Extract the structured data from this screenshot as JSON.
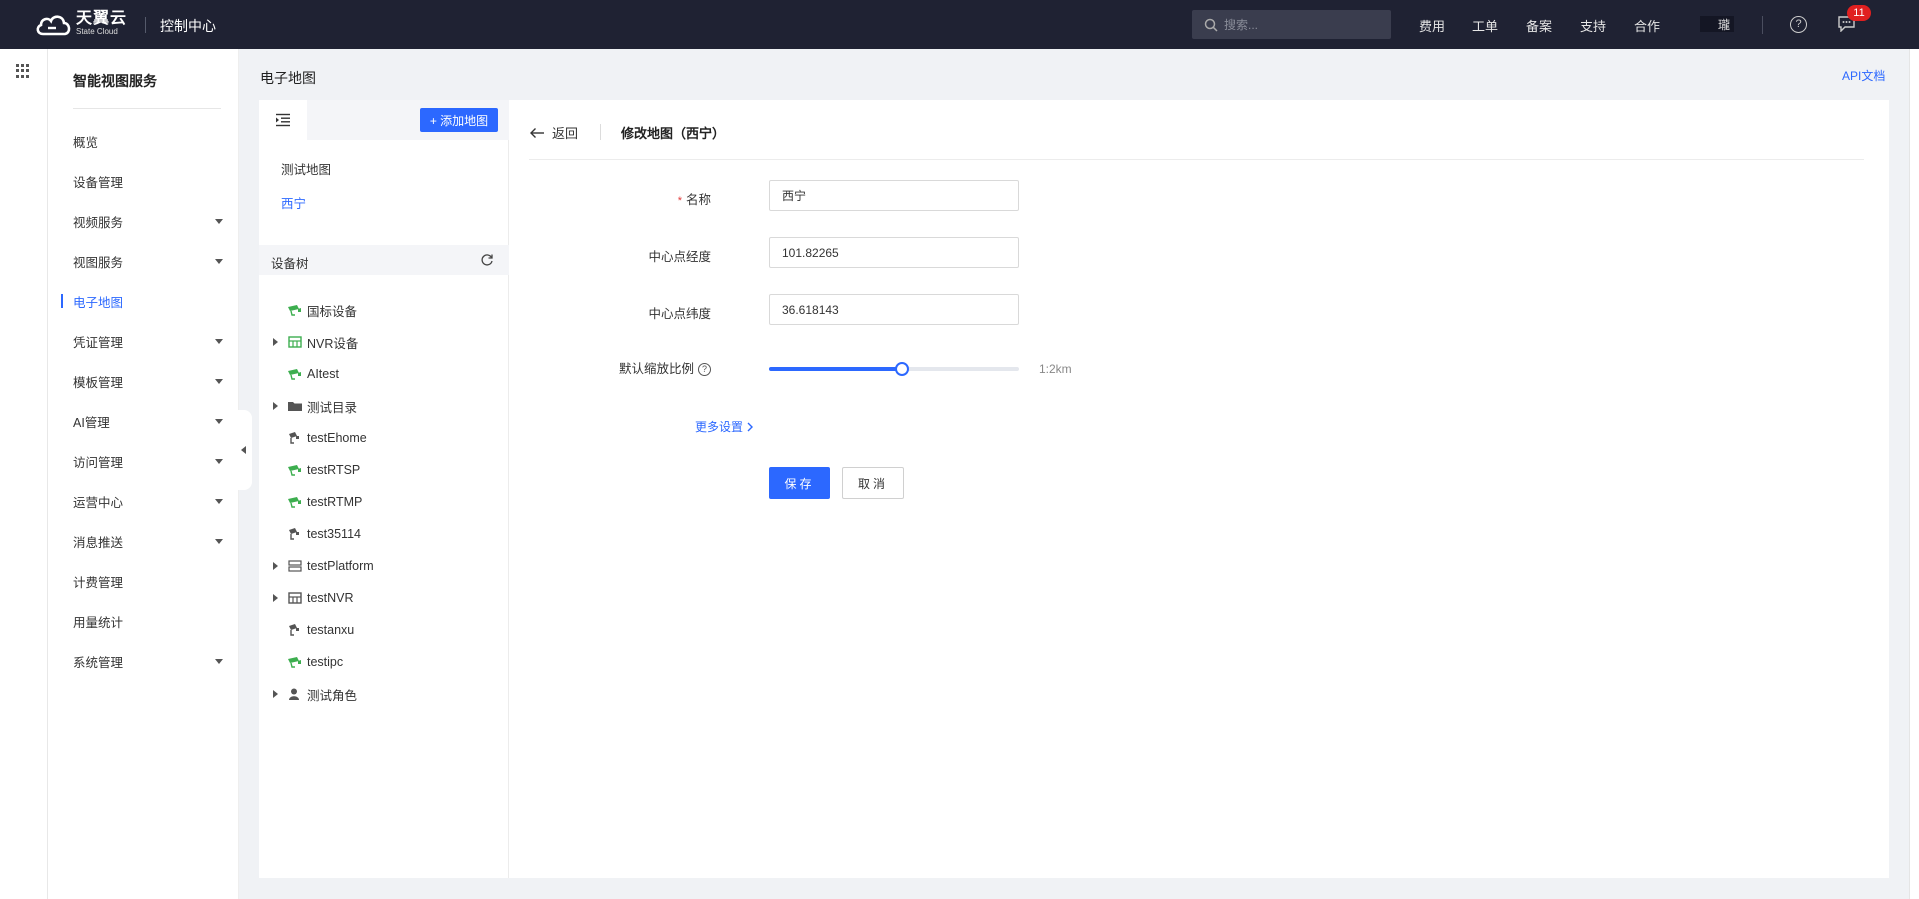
{
  "header": {
    "brand_cn": "天翼云",
    "brand_en": "State Cloud",
    "console_title": "控制中心",
    "search_placeholder": "搜索...",
    "nav": [
      "费用",
      "工单",
      "备案",
      "支持",
      "合作"
    ],
    "user_tag": "瓏",
    "message_badge": "11"
  },
  "sidebar": {
    "title": "智能视图服务",
    "items": [
      {
        "label": "概览",
        "has_caret": false
      },
      {
        "label": "设备管理",
        "has_caret": false
      },
      {
        "label": "视频服务",
        "has_caret": true
      },
      {
        "label": "视图服务",
        "has_caret": true
      },
      {
        "label": "电子地图",
        "has_caret": false,
        "active": true
      },
      {
        "label": "凭证管理",
        "has_caret": true
      },
      {
        "label": "模板管理",
        "has_caret": true
      },
      {
        "label": "AI管理",
        "has_caret": true
      },
      {
        "label": "访问管理",
        "has_caret": true
      },
      {
        "label": "运营中心",
        "has_caret": true
      },
      {
        "label": "消息推送",
        "has_caret": true
      },
      {
        "label": "计费管理",
        "has_caret": false
      },
      {
        "label": "用量统计",
        "has_caret": false
      },
      {
        "label": "系统管理",
        "has_caret": true
      }
    ]
  },
  "page": {
    "title": "电子地图",
    "api_doc": "API文档"
  },
  "map_panel": {
    "add_button": "+ 添加地图",
    "maps": [
      {
        "label": "测试地图",
        "selected": false
      },
      {
        "label": "西宁",
        "selected": true
      }
    ],
    "tree_title": "设备树",
    "tree": [
      {
        "label": "国标设备",
        "expandable": false,
        "icon": "camera-green-icon"
      },
      {
        "label": "NVR设备",
        "expandable": true,
        "icon": "nvr-green-icon"
      },
      {
        "label": "AItest",
        "expandable": false,
        "icon": "camera-green-icon"
      },
      {
        "label": "测试目录",
        "expandable": true,
        "icon": "folder-icon"
      },
      {
        "label": "testEhome",
        "expandable": false,
        "icon": "camera-gray-icon"
      },
      {
        "label": "testRTSP",
        "expandable": false,
        "icon": "camera-green-icon"
      },
      {
        "label": "testRTMP",
        "expandable": false,
        "icon": "camera-green-icon"
      },
      {
        "label": "test35114",
        "expandable": false,
        "icon": "camera-gray-icon"
      },
      {
        "label": "testPlatform",
        "expandable": true,
        "icon": "platform-icon"
      },
      {
        "label": "testNVR",
        "expandable": true,
        "icon": "nvr-gray-icon"
      },
      {
        "label": "testanxu",
        "expandable": false,
        "icon": "camera-gray-icon"
      },
      {
        "label": "testipc",
        "expandable": false,
        "icon": "camera-green-icon"
      },
      {
        "label": "测试角色",
        "expandable": true,
        "icon": "role-icon"
      }
    ]
  },
  "form": {
    "back_label": "返回",
    "title": "修改地图（西宁）",
    "name_label": "名称",
    "name_value": "西宁",
    "lng_label": "中心点经度",
    "lng_value": "101.82265",
    "lat_label": "中心点纬度",
    "lat_value": "36.618143",
    "zoom_label": "默认缩放比例",
    "zoom_fraction": 0.53,
    "zoom_value": "1:2km",
    "more_settings": "更多设置",
    "save": "保存",
    "cancel": "取消"
  },
  "colors": {
    "primary": "#2c68ff",
    "topbar": "#1f2233",
    "badge": "#e02020",
    "device_green": "#3dae4f"
  }
}
